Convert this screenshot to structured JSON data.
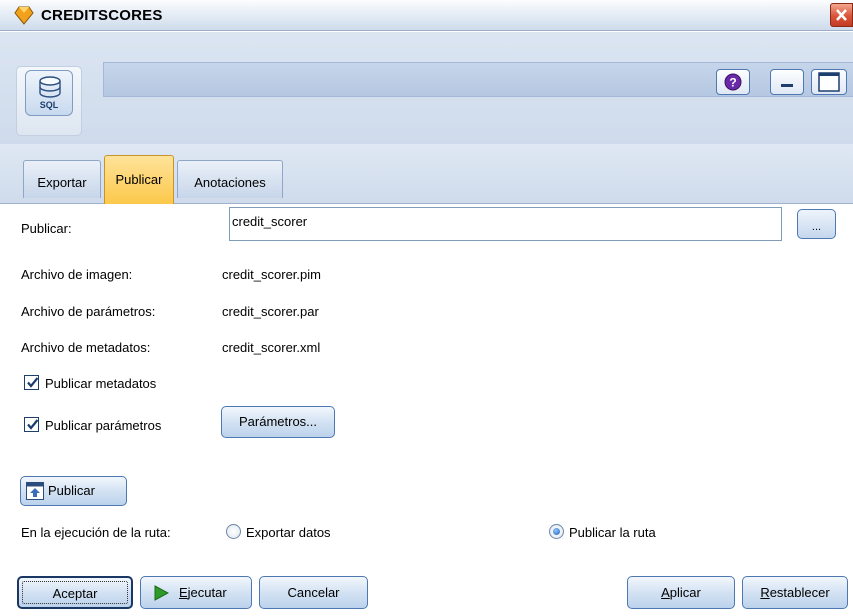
{
  "window": {
    "title": "CREDITSCORES"
  },
  "header": {
    "node_icon_label": "SQL"
  },
  "tabs": [
    {
      "label": "Exportar"
    },
    {
      "label": "Publicar"
    },
    {
      "label": "Anotaciones"
    }
  ],
  "publish": {
    "label": "Publicar:",
    "value": "credit_scorer",
    "browse_label": "..."
  },
  "files": {
    "image_label": "Archivo de imagen:",
    "image_value": "credit_scorer.pim",
    "params_label": "Archivo de parámetros:",
    "params_value": "credit_scorer.par",
    "metadata_label": "Archivo de metadatos:",
    "metadata_value": "credit_scorer.xml"
  },
  "options": {
    "publish_metadata": "Publicar metadatos",
    "publish_params": "Publicar parámetros",
    "params_button": "Parámetros..."
  },
  "publish_button": "Publicar",
  "execution": {
    "label": "En la ejecución de la ruta:",
    "option_export": "Exportar datos",
    "option_publish": "Publicar la ruta"
  },
  "footer": {
    "ok": "Aceptar",
    "run_rest": "jecutar",
    "run_mnemonic": "E",
    "cancel": "Cancelar",
    "apply_rest": "plicar",
    "apply_mnemonic": "A",
    "reset_rest": "establecer",
    "reset_mnemonic": "R"
  },
  "colors": {
    "accent": "#fbc84a",
    "header_bg": "#cfdbec",
    "button_border": "#4e78b2"
  }
}
